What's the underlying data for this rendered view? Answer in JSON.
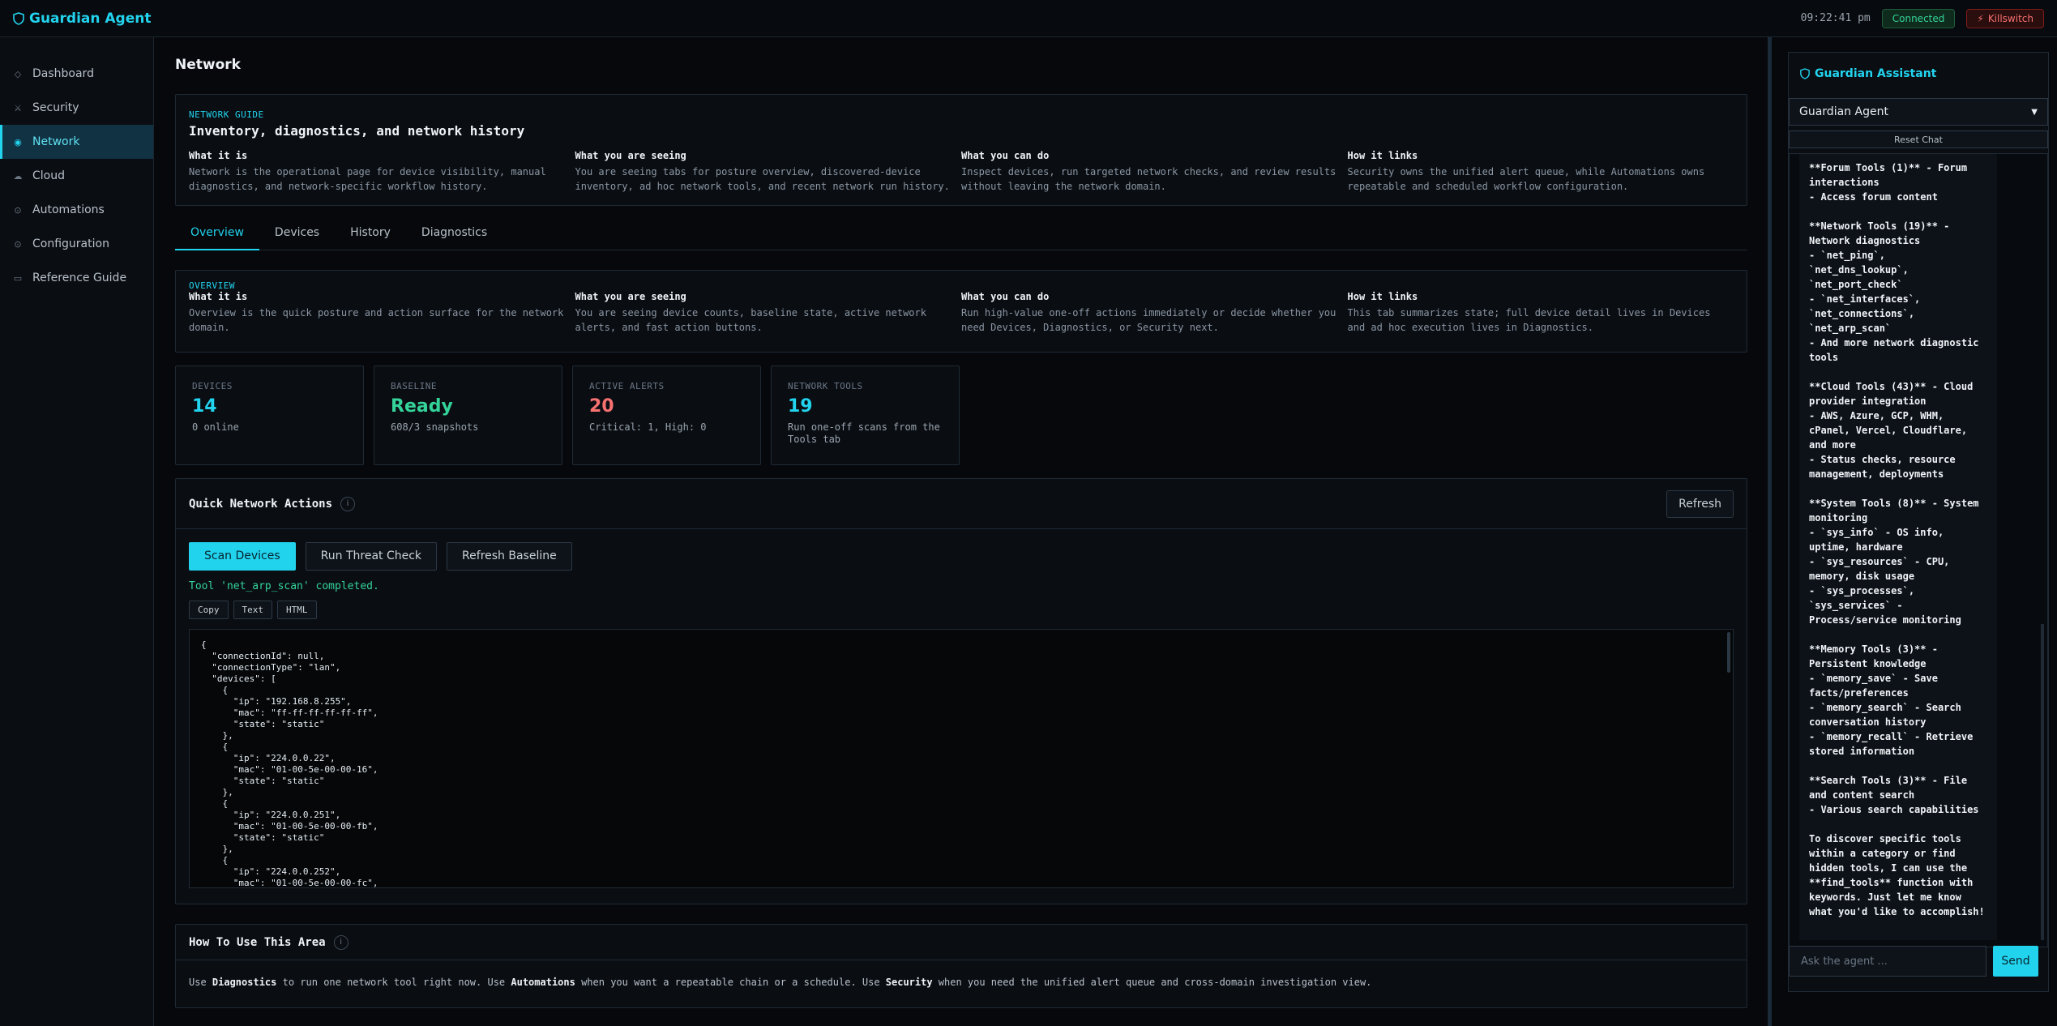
{
  "app": {
    "title": "Guardian Agent",
    "time": "09:22:41 pm",
    "connection_status": "Connected",
    "killswitch_label": "Killswitch"
  },
  "icons": {
    "brand": "shield-icon",
    "killswitch": "bolt-icon"
  },
  "sidebar": {
    "items": [
      {
        "label": "Dashboard",
        "icon": "◇"
      },
      {
        "label": "Security",
        "icon": "⚔"
      },
      {
        "label": "Network",
        "icon": "◉"
      },
      {
        "label": "Cloud",
        "icon": "☁"
      },
      {
        "label": "Automations",
        "icon": "⊙"
      },
      {
        "label": "Configuration",
        "icon": "⊙"
      },
      {
        "label": "Reference Guide",
        "icon": "▭"
      }
    ],
    "active": "Network"
  },
  "page": {
    "title": "Network"
  },
  "network_guide": {
    "kicker": "NETWORK GUIDE",
    "title": "Inventory, diagnostics, and network history",
    "cols": [
      {
        "heading": "What it is",
        "text": "Network is the operational page for device visibility, manual diagnostics, and network-specific workflow history."
      },
      {
        "heading": "What you are seeing",
        "text": "You are seeing tabs for posture overview, discovered-device inventory, ad hoc network tools, and recent network run history."
      },
      {
        "heading": "What you can do",
        "text": "Inspect devices, run targeted network checks, and review results without leaving the network domain."
      },
      {
        "heading": "How it links",
        "text": "Security owns the unified alert queue, while Automations owns repeatable and scheduled workflow configuration."
      }
    ]
  },
  "tabs": [
    {
      "label": "Overview",
      "active": true
    },
    {
      "label": "Devices"
    },
    {
      "label": "History"
    },
    {
      "label": "Diagnostics"
    }
  ],
  "overview_guide": {
    "kicker": "OVERVIEW",
    "cols": [
      {
        "heading": "What it is",
        "text": "Overview is the quick posture and action surface for the network domain."
      },
      {
        "heading": "What you are seeing",
        "text": "You are seeing device counts, baseline state, active network alerts, and fast action buttons."
      },
      {
        "heading": "What you can do",
        "text": "Run high-value one-off actions immediately or decide whether you need Devices, Diagnostics, or Security next."
      },
      {
        "heading": "How it links",
        "text": "This tab summarizes state; full device detail lives in Devices and ad hoc execution lives in Diagnostics."
      }
    ]
  },
  "stats": [
    {
      "label": "DEVICES",
      "value": "14",
      "sub": "0 online",
      "color": "#22d3ee"
    },
    {
      "label": "BASELINE",
      "value": "Ready",
      "sub": "608/3 snapshots",
      "color": "#34d399"
    },
    {
      "label": "ACTIVE ALERTS",
      "value": "20",
      "sub": "Critical: 1, High: 0",
      "color": "#f87171"
    },
    {
      "label": "NETWORK TOOLS",
      "value": "19",
      "sub": "Run one-off scans from the Tools tab",
      "color": "#22d3ee"
    }
  ],
  "quick_actions": {
    "title": "Quick Network Actions",
    "refresh_label": "Refresh",
    "buttons": [
      "Scan Devices",
      "Run Threat Check",
      "Refresh Baseline"
    ],
    "status": "Tool 'net_arp_scan' completed.",
    "formats": [
      "Copy",
      "Text",
      "HTML"
    ],
    "output": "{\n  \"connectionId\": null,\n  \"connectionType\": \"lan\",\n  \"devices\": [\n    {\n      \"ip\": \"192.168.8.255\",\n      \"mac\": \"ff-ff-ff-ff-ff-ff\",\n      \"state\": \"static\"\n    },\n    {\n      \"ip\": \"224.0.0.22\",\n      \"mac\": \"01-00-5e-00-00-16\",\n      \"state\": \"static\"\n    },\n    {\n      \"ip\": \"224.0.0.251\",\n      \"mac\": \"01-00-5e-00-00-fb\",\n      \"state\": \"static\"\n    },\n    {\n      \"ip\": \"224.0.0.252\",\n      \"mac\": \"01-00-5e-00-00-fc\","
  },
  "how_to": {
    "title": "How To Use This Area",
    "parts": [
      "Use ",
      "Diagnostics",
      " to run one network tool right now. Use ",
      "Automations",
      " when you want a repeatable chain or a schedule. Use ",
      "Security",
      " when you need the unified alert queue and cross-domain investigation view."
    ]
  },
  "assistant": {
    "title": "Guardian Assistant",
    "agent_select": "Guardian Agent",
    "reset_label": "Reset Chat",
    "message": "**Forum Tools (1)** - Forum interactions\n- Access forum content\n\n**Network Tools (19)** - Network diagnostics\n- `net_ping`, `net_dns_lookup`, `net_port_check`\n- `net_interfaces`, `net_connections`, `net_arp_scan`\n- And more network diagnostic tools\n\n**Cloud Tools (43)** - Cloud provider integration\n- AWS, Azure, GCP, WHM, cPanel, Vercel, Cloudflare, and more\n- Status checks, resource management, deployments\n\n**System Tools (8)** - System monitoring\n- `sys_info` - OS info, uptime, hardware\n- `sys_resources` - CPU, memory, disk usage\n- `sys_processes`, `sys_services` - Process/service monitoring\n\n**Memory Tools (3)** - Persistent knowledge\n- `memory_save` - Save facts/preferences\n- `memory_search` - Search conversation history\n- `memory_recall` - Retrieve stored information\n\n**Search Tools (3)** - File and content search\n- Various search capabilities\n\nTo discover specific tools within a category or find hidden tools, I can use the **find_tools** function with keywords. Just let me know what you'd like to accomplish!",
    "input_placeholder": "Ask the agent ...",
    "send_label": "Send"
  }
}
